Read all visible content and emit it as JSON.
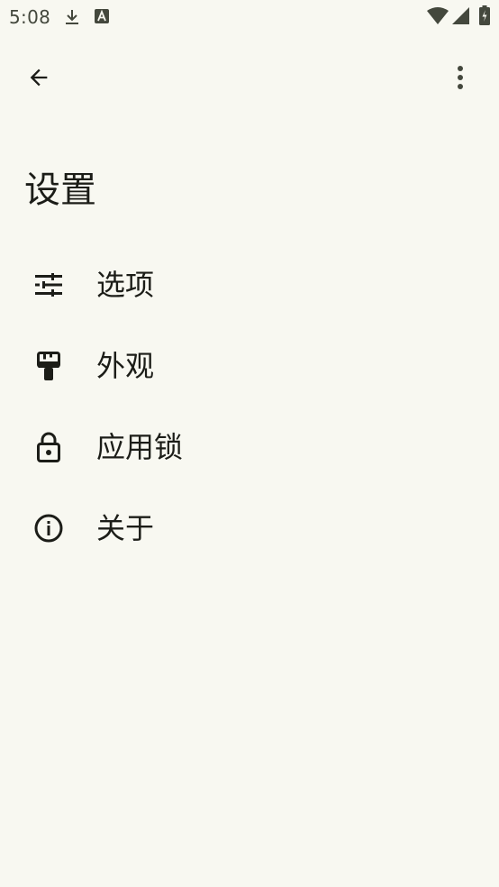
{
  "status_bar": {
    "time": "5:08",
    "icons": [
      "download-icon",
      "text-a-icon",
      "wifi-icon",
      "signal-icon",
      "battery-icon"
    ]
  },
  "toolbar": {
    "back_icon": "arrow-back-icon",
    "more_icon": "more-vert-icon"
  },
  "page": {
    "title": "设置"
  },
  "menu": {
    "items": [
      {
        "label": "选项",
        "icon": "tune-icon"
      },
      {
        "label": "外观",
        "icon": "paint-roller-icon"
      },
      {
        "label": "应用锁",
        "icon": "lock-icon"
      },
      {
        "label": "关于",
        "icon": "info-icon"
      }
    ]
  },
  "colors": {
    "background": "#f8f8f1",
    "text": "#1c1d18",
    "status": "#44483d"
  }
}
